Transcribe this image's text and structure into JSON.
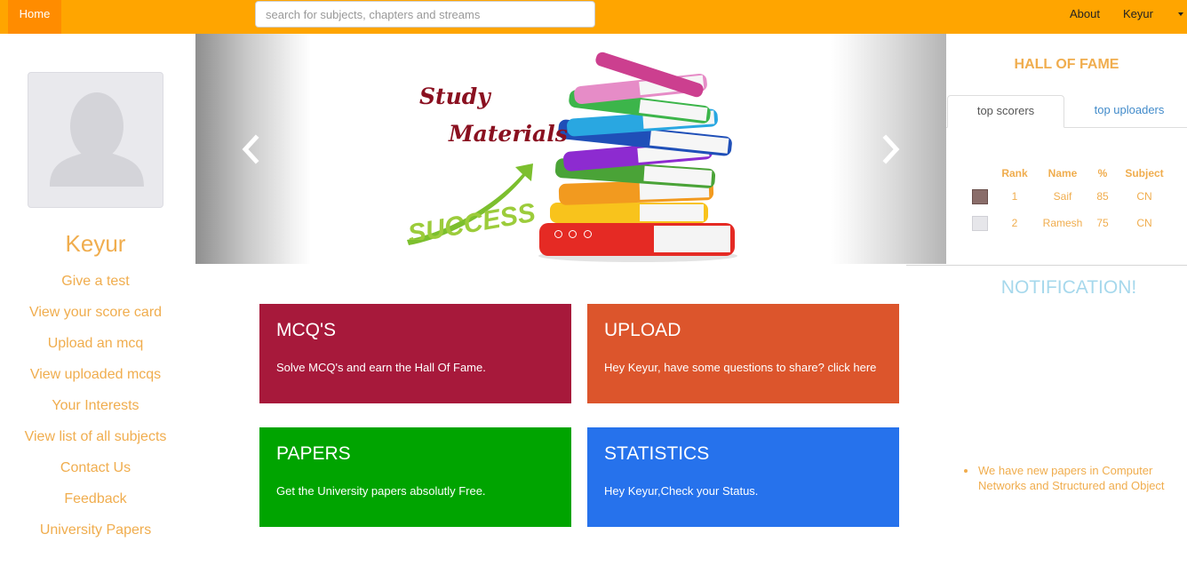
{
  "nav": {
    "home_label": "Home",
    "search_placeholder": "search for subjects, chapters and streams",
    "about_label": "About",
    "user_label": "Keyur"
  },
  "sidebar": {
    "profile_name": "Keyur",
    "links": [
      {
        "label": "Give a test"
      },
      {
        "label": "View your score card"
      },
      {
        "label": "Upload an mcq"
      },
      {
        "label": "View uploaded mcqs"
      },
      {
        "label": "Your Interests"
      },
      {
        "label": "View list of all subjects"
      },
      {
        "label": "Contact Us"
      },
      {
        "label": "Feedback"
      },
      {
        "label": "University Papers"
      }
    ]
  },
  "carousel": {
    "line1": "Study",
    "line2": "Materials",
    "success_text": "SUCCESS",
    "active_slide": 1,
    "slide_count": 3
  },
  "tiles": {
    "mcq": {
      "title": "MCQ'S",
      "desc": "Solve MCQ's and earn the Hall Of Fame."
    },
    "upload": {
      "title": "UPLOAD",
      "desc": "Hey Keyur, have some questions to share? click here"
    },
    "papers": {
      "title": "PAPERS",
      "desc": "Get the University papers absolutly Free."
    },
    "stats": {
      "title": "STATISTICS",
      "desc": "Hey Keyur,Check your Status."
    }
  },
  "hall_of_fame": {
    "title": "HALL OF FAME",
    "tabs": [
      "top scorers",
      "top uploaders"
    ],
    "active_tab": "top scorers",
    "columns": [
      "Rank",
      "Name",
      "%",
      "Subject"
    ],
    "rows": [
      {
        "rank": "1",
        "name": "Saif",
        "pct": "85",
        "subject": "CN"
      },
      {
        "rank": "2",
        "name": "Ramesh",
        "pct": "75",
        "subject": "CN"
      }
    ]
  },
  "notification": {
    "title": "NOTIFICATION!",
    "items": [
      "We have new papers in Computer Networks and Structured and Object"
    ]
  },
  "colors": {
    "navbar": "#ffa500",
    "home_active": "#ff8c00",
    "link": "#f0ad4e",
    "mcq_tile": "#a7193b",
    "upload_tile": "#dc552c",
    "papers_tile": "#00a400",
    "stats_tile": "#2672ec",
    "notification_title": "#a6d8ec"
  }
}
